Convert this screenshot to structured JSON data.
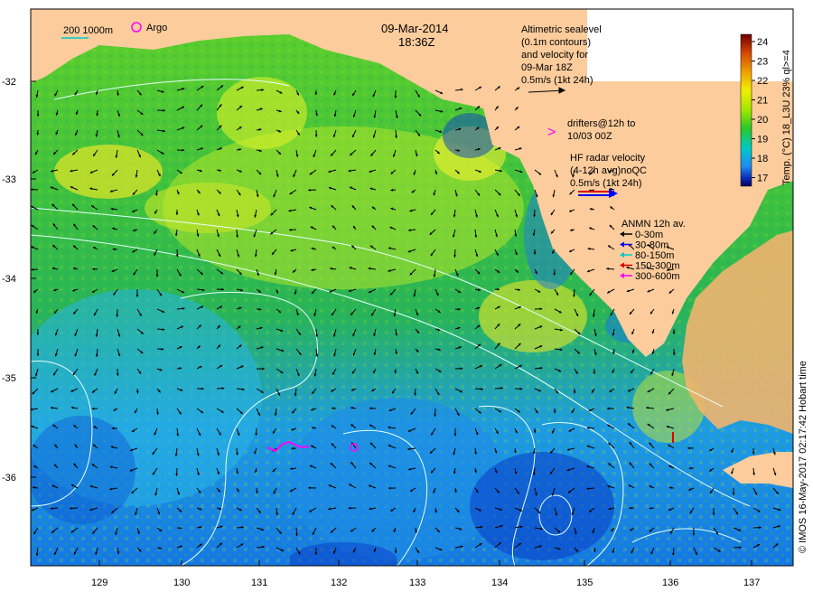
{
  "map": {
    "date": "09-Mar-2014",
    "time": "18:36Z",
    "scale_label": "200  1000m",
    "argo_label": "Argo",
    "altimetry_lines": [
      "Altimetric sealevel",
      "(0.1m contours)",
      "and velocity for",
      "09-Mar 18Z",
      "0.5m/s (1kt 24h)"
    ],
    "drifters_lines": [
      "drifters@12h to",
      "10/03 00Z"
    ],
    "drifters_symbol": ">",
    "hf_radar_lines": [
      "HF radar velocity",
      "(4-12h avg)noQC",
      "0.5m/s (1kt 24h)"
    ],
    "anmn": {
      "title": "ANMN 12h av.",
      "items": [
        {
          "label": "0-30m",
          "color": "#000000"
        },
        {
          "label": "30-80m",
          "color": "#0000ff"
        },
        {
          "label": "80-150m",
          "color": "#00c8c8"
        },
        {
          "label": "150-300m",
          "color": "#e00000"
        },
        {
          "label": "300-600m",
          "color": "#ff00ff"
        }
      ]
    },
    "colorbar": {
      "title": "Temp. (°C) 18_L3U 23% ql>=4",
      "ticks": [
        "24",
        "23",
        "22",
        "21",
        "20",
        "19",
        "18",
        "17"
      ],
      "stops": [
        "#6e0000",
        "#d24600",
        "#f0a000",
        "#f0f000",
        "#a0e600",
        "#28c828",
        "#00c8c8",
        "#1e8cf0",
        "#0a28b4",
        "#00005a"
      ]
    },
    "credit": "© IMOS 16-May-2017 02:17:42 Hobart time",
    "lat_ticks": [
      "-32",
      "-33",
      "-34",
      "-35",
      "-36"
    ],
    "lon_ticks": [
      "129",
      "130",
      "131",
      "132",
      "133",
      "134",
      "135",
      "136",
      "137"
    ],
    "colors": {
      "land": "#fccc9c",
      "ocean_warm": "#50c830",
      "ocean_cool": "#1e9cf0",
      "ocean_deep": "#0a32c8",
      "contour": "#e6ffff",
      "magenta": "#ff00ff"
    }
  }
}
